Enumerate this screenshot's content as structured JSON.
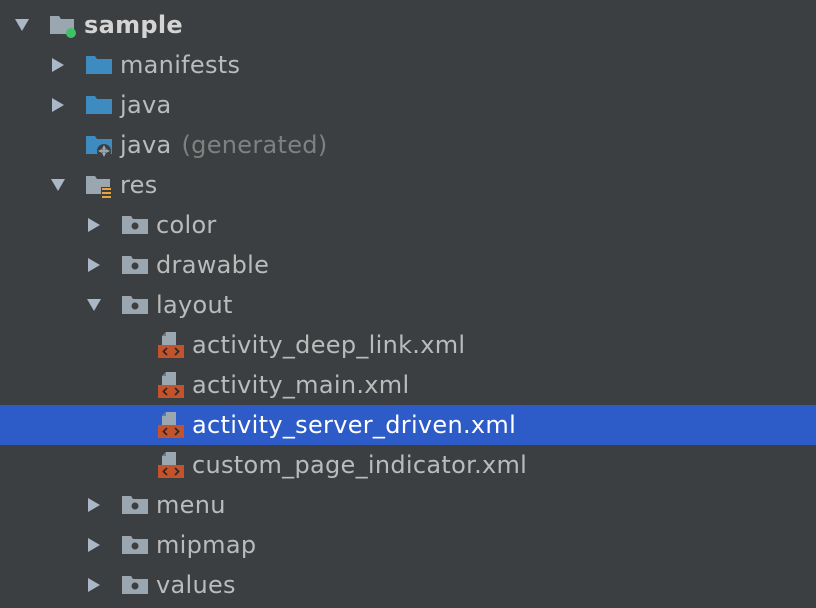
{
  "tree": {
    "root": {
      "label": "sample",
      "expanded": true,
      "icon": "module-folder-icon"
    },
    "manifests": {
      "label": "manifests",
      "expanded": false,
      "icon": "folder-icon"
    },
    "java": {
      "label": "java",
      "expanded": false,
      "icon": "folder-icon"
    },
    "java_generated": {
      "label": "java",
      "hint": "(generated)",
      "icon": "generated-source-folder-icon"
    },
    "res": {
      "label": "res",
      "expanded": true,
      "icon": "resources-folder-icon"
    },
    "color": {
      "label": "color",
      "expanded": false,
      "icon": "package-folder-icon"
    },
    "drawable": {
      "label": "drawable",
      "expanded": false,
      "icon": "package-folder-icon"
    },
    "layout": {
      "label": "layout",
      "expanded": true,
      "icon": "package-folder-icon"
    },
    "files": [
      {
        "label": "activity_deep_link.xml",
        "icon": "xml-layout-file-icon"
      },
      {
        "label": "activity_main.xml",
        "icon": "xml-layout-file-icon"
      },
      {
        "label": "activity_server_driven.xml",
        "icon": "xml-layout-file-icon",
        "selected": true
      },
      {
        "label": "custom_page_indicator.xml",
        "icon": "xml-layout-file-icon"
      }
    ],
    "menu": {
      "label": "menu",
      "expanded": false,
      "icon": "package-folder-icon"
    },
    "mipmap": {
      "label": "mipmap",
      "expanded": false,
      "icon": "package-folder-icon"
    },
    "values": {
      "label": "values",
      "expanded": false,
      "icon": "package-folder-icon"
    }
  },
  "colors": {
    "background": "#3c3f41",
    "selection": "#2d5bc8",
    "text": "#bbbbbb",
    "hint_text": "#808080",
    "folder_blue": "#3d8bc1",
    "folder_gray": "#9aa7b0",
    "xml_badge": "#c4532c",
    "module_dot": "#3fc168"
  }
}
